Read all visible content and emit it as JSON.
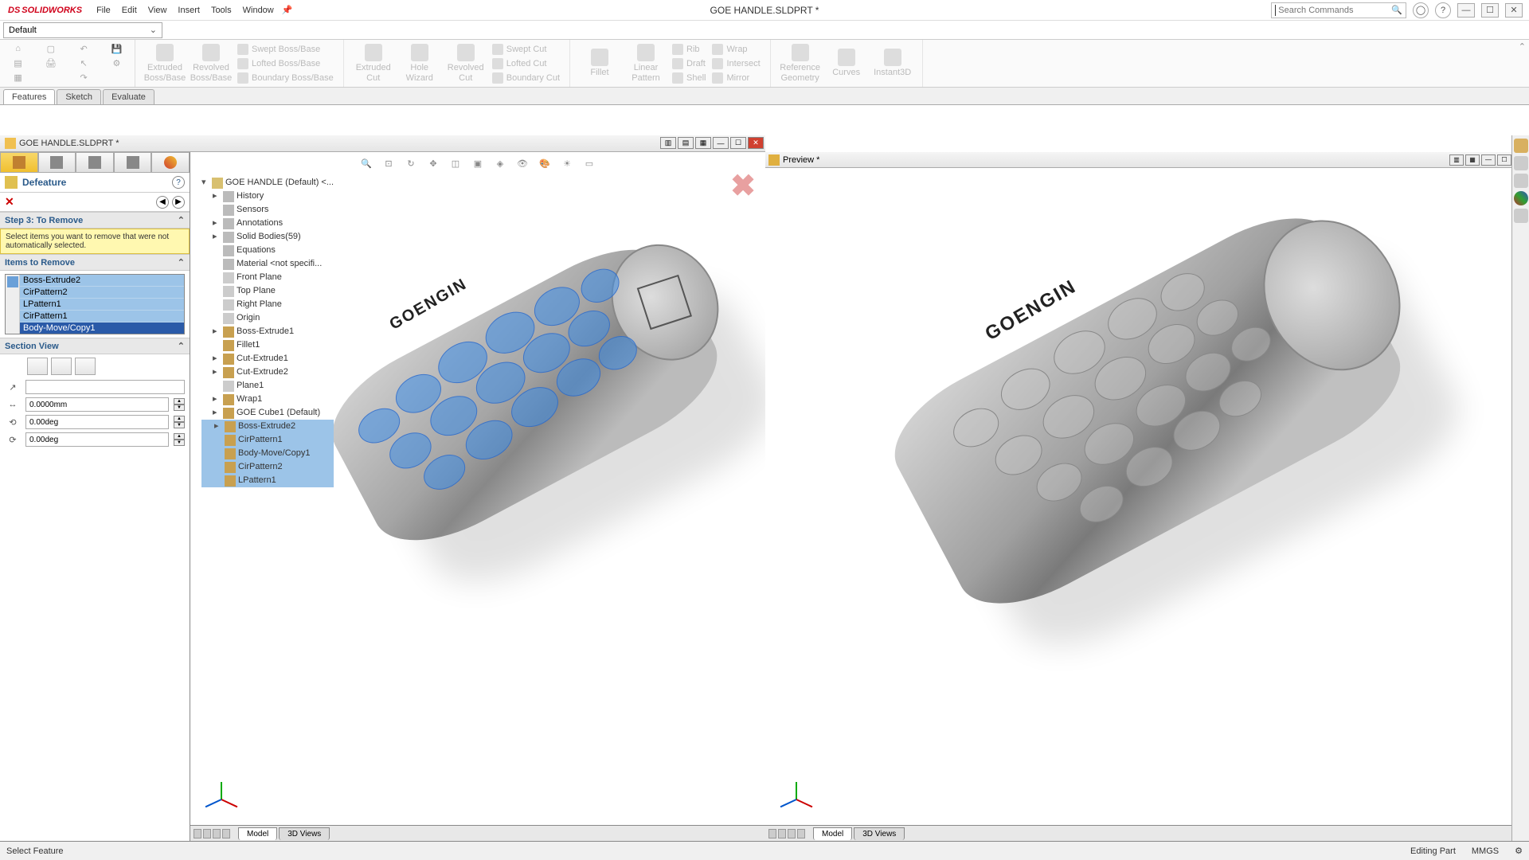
{
  "app_name": "SOLIDWORKS",
  "document_title": "GOE HANDLE.SLDPRT *",
  "menu": [
    "File",
    "Edit",
    "View",
    "Insert",
    "Tools",
    "Window"
  ],
  "search_placeholder": "Search Commands",
  "config_dropdown": "Default",
  "tabs": [
    "Features",
    "Sketch",
    "Evaluate"
  ],
  "active_tab": "Features",
  "ribbon": {
    "g1": [
      {
        "label": "Extruded Boss/Base"
      },
      {
        "label": "Revolved Boss/Base"
      }
    ],
    "g1small": [
      "Swept Boss/Base",
      "Lofted Boss/Base",
      "Boundary Boss/Base"
    ],
    "g2": [
      {
        "label": "Extruded Cut"
      },
      {
        "label": "Hole Wizard"
      },
      {
        "label": "Revolved Cut"
      }
    ],
    "g2small": [
      "Swept Cut",
      "Lofted Cut",
      "Boundary Cut"
    ],
    "g3": [
      {
        "label": "Fillet"
      },
      {
        "label": "Linear Pattern"
      }
    ],
    "g3small": [
      "Rib",
      "Draft",
      "Shell",
      "Wrap",
      "Intersect",
      "Mirror"
    ],
    "g4": [
      {
        "label": "Reference Geometry"
      },
      {
        "label": "Curves"
      },
      {
        "label": "Instant3D"
      }
    ]
  },
  "doc_tab_name": "GOE HANDLE.SLDPRT *",
  "pm": {
    "title": "Defeature",
    "step_header": "Step 3: To Remove",
    "hint": "Select items you want to remove that were not automatically selected.",
    "items_header": "Items to Remove",
    "items": [
      "Boss-Extrude2",
      "CirPattern2",
      "LPattern1",
      "CirPattern1",
      "Body-Move/Copy1"
    ],
    "section_view": "Section View",
    "val_dist": "0.0000mm",
    "val_ang1": "0.00deg",
    "val_ang2": "0.00deg"
  },
  "tree": {
    "root": "GOE HANDLE (Default) <...",
    "items": [
      "History",
      "Sensors",
      "Annotations",
      "Solid Bodies(59)",
      "Equations",
      "Material <not specifi...",
      "Front Plane",
      "Top Plane",
      "Right Plane",
      "Origin",
      "Boss-Extrude1",
      "Fillet1",
      "Cut-Extrude1",
      "Cut-Extrude2",
      "Plane1",
      "Wrap1",
      "GOE Cube1 (Default)",
      "Boss-Extrude2",
      "CirPattern1",
      "Body-Move/Copy1",
      "CirPattern2",
      "LPattern1"
    ]
  },
  "cylinder_text": "GOENGIN",
  "preview_label": "Preview *",
  "bottom_tabs": [
    "Model",
    "3D Views"
  ],
  "status_left": "Select Feature",
  "status_right": "Editing Part",
  "status_units": "MMGS"
}
